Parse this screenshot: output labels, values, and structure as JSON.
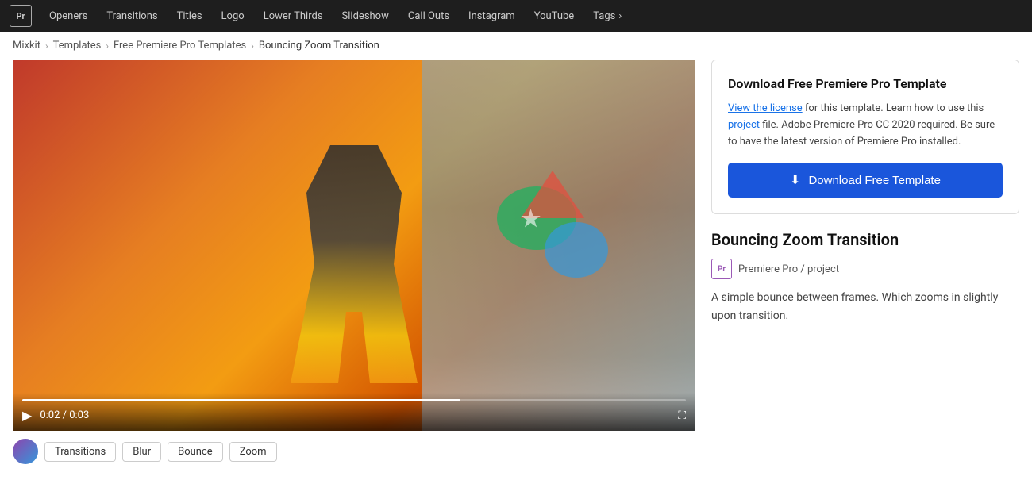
{
  "nav": {
    "logo_label": "Pr",
    "items": [
      {
        "label": "Openers",
        "id": "openers"
      },
      {
        "label": "Transitions",
        "id": "transitions"
      },
      {
        "label": "Titles",
        "id": "titles"
      },
      {
        "label": "Logo",
        "id": "logo"
      },
      {
        "label": "Lower Thirds",
        "id": "lower-thirds"
      },
      {
        "label": "Slideshow",
        "id": "slideshow"
      },
      {
        "label": "Call Outs",
        "id": "call-outs"
      },
      {
        "label": "Instagram",
        "id": "instagram"
      },
      {
        "label": "YouTube",
        "id": "youtube"
      },
      {
        "label": "Tags",
        "id": "tags"
      },
      {
        "label": "›",
        "id": "more"
      }
    ]
  },
  "breadcrumb": {
    "items": [
      {
        "label": "Mixkit",
        "href": "#"
      },
      {
        "label": "Templates",
        "href": "#"
      },
      {
        "label": "Free Premiere Pro Templates",
        "href": "#"
      },
      {
        "label": "Bouncing Zoom Transition",
        "href": null
      }
    ]
  },
  "video": {
    "current_time": "0:02",
    "total_time": "0:03",
    "progress_percent": 66
  },
  "tags": [
    {
      "label": "Transitions"
    },
    {
      "label": "Blur"
    },
    {
      "label": "Bounce"
    },
    {
      "label": "Zoom"
    }
  ],
  "download_card": {
    "title": "Download Free Premiere Pro Template",
    "description_parts": {
      "before_link1": "",
      "link1_text": "View the license",
      "middle_text": " for this template. Learn how to use this ",
      "link2_text": "project",
      "after_link2": " file. Adobe Premiere Pro CC 2020 required. Be sure to have the latest version of Premiere Pro installed."
    },
    "button_label": "Download Free Template"
  },
  "product": {
    "title": "Bouncing Zoom Transition",
    "badge_label": "Pr",
    "meta_text": "Premiere Pro / project",
    "description": "A simple bounce between frames. Which zooms in slightly upon transition."
  }
}
